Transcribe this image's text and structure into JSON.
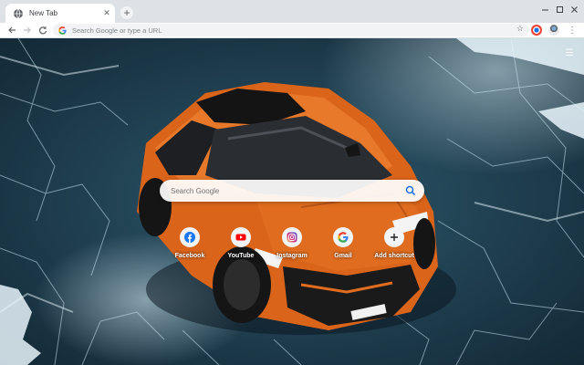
{
  "tabs": [
    {
      "title": "New Tab",
      "icon": "globe-icon"
    }
  ],
  "toolbar": {
    "omnibox_placeholder": "Search Google or type a URL"
  },
  "page": {
    "search_placeholder": "Search Google",
    "shortcuts": [
      {
        "label": "Facebook",
        "icon": "facebook-icon",
        "color": "#1877f2"
      },
      {
        "label": "YouTube",
        "icon": "youtube-icon",
        "color": "#ff0000"
      },
      {
        "label": "Instagram",
        "icon": "instagram-icon",
        "color": "#c13584"
      },
      {
        "label": "Gmail",
        "icon": "google-icon",
        "color": "#4285f4"
      },
      {
        "label": "Add shortcut",
        "icon": "plus-icon",
        "color": "#202124"
      }
    ]
  },
  "colors": {
    "tabstrip": "#dee1e6",
    "car_orange": "#e0701e",
    "ice": "#1d3b4b"
  }
}
